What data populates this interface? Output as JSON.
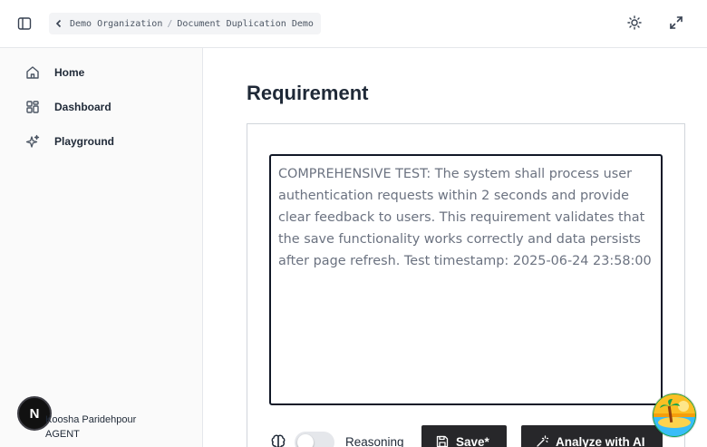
{
  "header": {
    "breadcrumb": [
      {
        "label": "Demo Organization"
      },
      {
        "label": "Document Duplication Demo"
      }
    ],
    "separator": "/"
  },
  "sidebar": {
    "items": [
      {
        "label": "Home",
        "icon": "home-icon"
      },
      {
        "label": "Dashboard",
        "icon": "dashboard-icon"
      },
      {
        "label": "Playground",
        "icon": "sparkles-icon"
      }
    ],
    "user": {
      "avatar_letter": "N",
      "name": "Koosha Paridehpour",
      "role": "AGENT"
    }
  },
  "main": {
    "title": "Requirement",
    "requirement_text": "COMPREHENSIVE TEST: The system shall process user authentication requests within 2 seconds and provide clear feedback to users. This requirement validates that the save functionality works correctly and data persists after page refresh. Test timestamp: 2025-06-24 23:58:00",
    "reasoning_label": "Reasoning",
    "reasoning_enabled": false,
    "save_label": "Save*",
    "analyze_label": "Analyze with AI"
  },
  "colors": {
    "button_bg": "#27272a",
    "sidebar_bg": "#fafafa",
    "border": "#e5e7eb"
  }
}
